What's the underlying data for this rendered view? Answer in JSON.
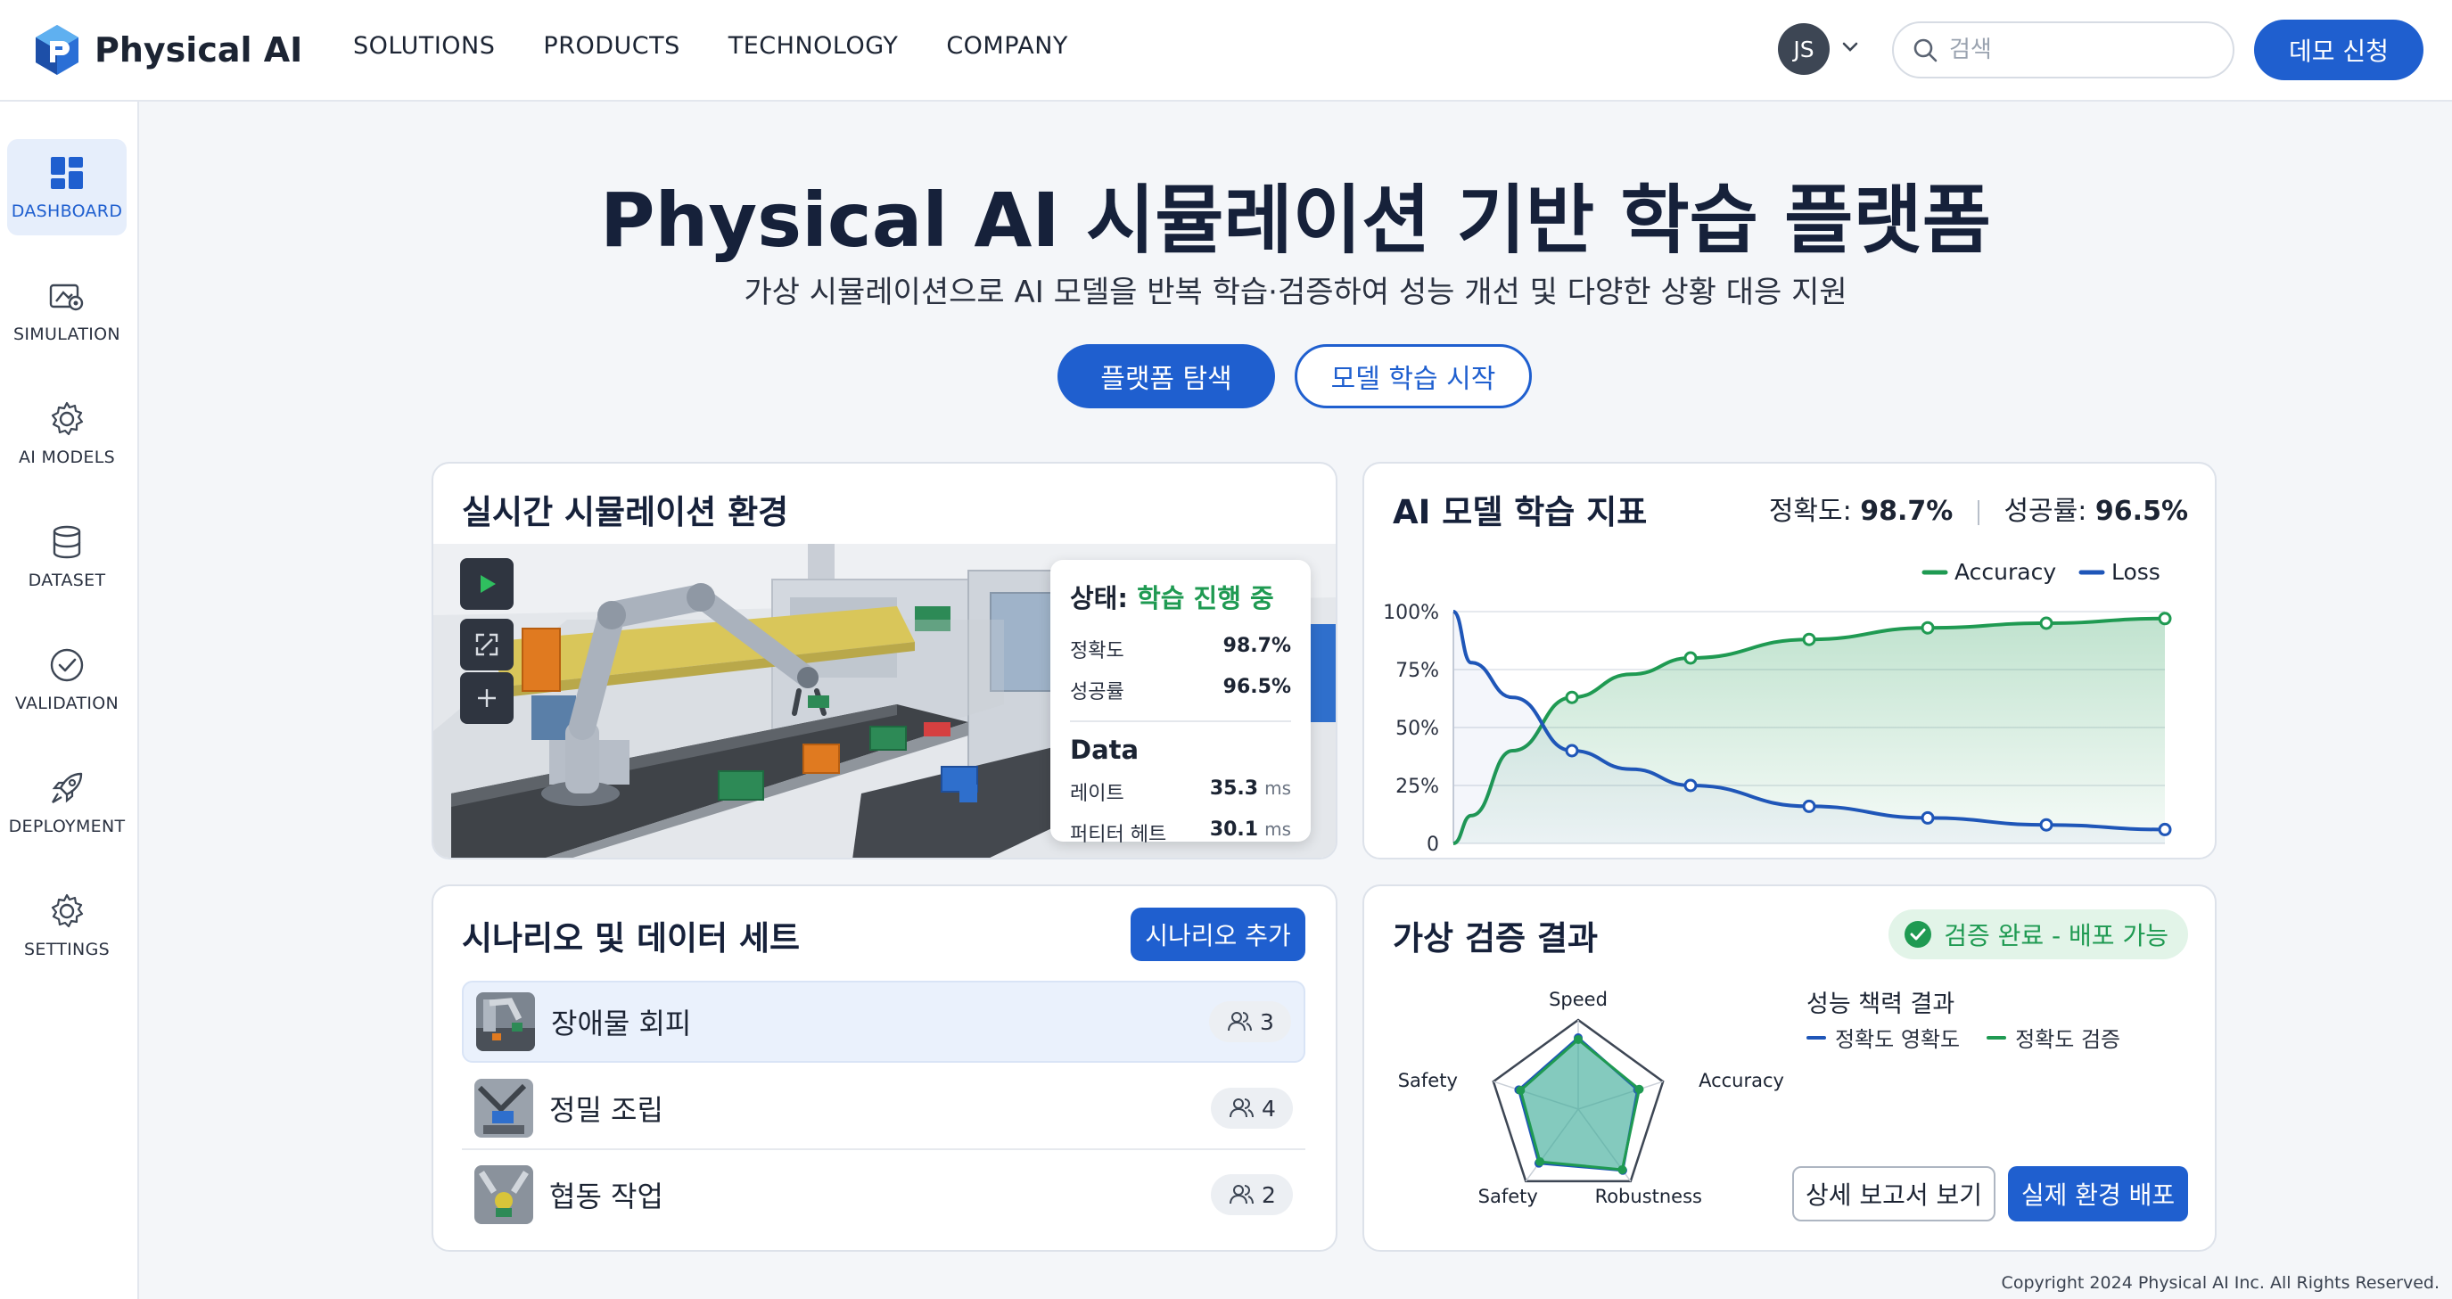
{
  "brand": {
    "name": "Physical AI",
    "primary": "#1f5fcf",
    "success": "#1f9a52"
  },
  "nav": [
    "SOLUTIONS",
    "PRODUCTS",
    "TECHNOLOGY",
    "COMPANY"
  ],
  "header": {
    "avatar_initials": "JS",
    "search_placeholder": "검색",
    "demo_label": "데모 신청"
  },
  "sidebar": [
    {
      "label": "DASHBOARD",
      "icon": "dashboard-icon",
      "active": true
    },
    {
      "label": "SIMULATION",
      "icon": "simulation-icon",
      "active": false
    },
    {
      "label": "AI MODELS",
      "icon": "gear-icon",
      "active": false
    },
    {
      "label": "DATASET",
      "icon": "database-icon",
      "active": false
    },
    {
      "label": "VALIDATION",
      "icon": "check-circle-icon",
      "active": false
    },
    {
      "label": "DEPLOYMENT",
      "icon": "rocket-icon",
      "active": false
    },
    {
      "label": "SETTINGS",
      "icon": "gear-icon",
      "active": false
    }
  ],
  "hero": {
    "title": "Physical AI 시뮬레이션 기반 학습 플랫폼",
    "subtitle": "가상 시뮬레이션으로 AI 모델을 반복 학습·검증하여 성능 개선 및 다양한 상황 대응 지원",
    "primary_button": "플랫폼 탐색",
    "secondary_button": "모델 학습 시작"
  },
  "simulation": {
    "title": "실시간 시뮬레이션 환경",
    "status_label": "상태:",
    "status_value": "학습 진행 중",
    "metrics": [
      {
        "label": "정확도",
        "value": "98.7%"
      },
      {
        "label": "성공률",
        "value": "96.5%"
      }
    ],
    "data_title": "Data",
    "data_rows": [
      {
        "label": "레이트",
        "value": "35.3",
        "unit": "ms"
      },
      {
        "label": "퍼티터 헤트",
        "value": "30.1",
        "unit": "ms"
      }
    ]
  },
  "metrics_card": {
    "title": "AI 모델 학습 지표",
    "accuracy_label": "정확도:",
    "accuracy_value": "98.7%",
    "success_label": "성공률:",
    "success_value": "96.5%"
  },
  "chart_data": {
    "type": "line",
    "x": [
      0,
      100,
      200,
      300,
      400,
      500,
      600
    ],
    "x_ticks": [
      "0",
      "100",
      "200",
      "300",
      "400",
      "500",
      "600"
    ],
    "y_ticks": [
      "0",
      "25%",
      "50%",
      "75%",
      "100%"
    ],
    "ylim": [
      0,
      100
    ],
    "xlim": [
      0,
      600
    ],
    "grid": true,
    "legend_position": "top-right",
    "series": [
      {
        "name": "Accuracy",
        "color": "#1f9a52",
        "fill": true,
        "points": [
          [
            0,
            0
          ],
          [
            15,
            12
          ],
          [
            50,
            40
          ],
          [
            100,
            63
          ],
          [
            150,
            73
          ],
          [
            200,
            80
          ],
          [
            300,
            88
          ],
          [
            400,
            93
          ],
          [
            500,
            95
          ],
          [
            600,
            97
          ]
        ],
        "markers": [
          100,
          200,
          300,
          400,
          500,
          600
        ]
      },
      {
        "name": "Loss",
        "color": "#1f56b8",
        "fill": false,
        "points": [
          [
            0,
            100
          ],
          [
            15,
            78
          ],
          [
            50,
            63
          ],
          [
            100,
            40
          ],
          [
            150,
            32
          ],
          [
            200,
            25
          ],
          [
            300,
            16
          ],
          [
            400,
            11
          ],
          [
            500,
            8
          ],
          [
            600,
            6
          ]
        ],
        "markers": [
          100,
          200,
          300,
          400,
          500,
          600
        ]
      }
    ]
  },
  "scenarios": {
    "title": "시나리오 및 데이터 세트",
    "add_label": "시나리오 추가",
    "items": [
      {
        "name": "장애물 회피",
        "count": "3"
      },
      {
        "name": "정밀 조립",
        "count": "4"
      },
      {
        "name": "협동 작업",
        "count": "2"
      }
    ]
  },
  "validation": {
    "title": "가상 검증 결과",
    "badge": "검증 완료 - 배포 가능",
    "perf_title": "성능 책력 결과",
    "legend": [
      {
        "name": "정확도 영확도",
        "color": "#1f56b8"
      },
      {
        "name": "정확도 검증",
        "color": "#1f9a52"
      }
    ],
    "report_button": "상세 보고서 보기",
    "deploy_button": "실제 환경 배포",
    "radar": {
      "axes": [
        "Speed",
        "Accuracy",
        "Robustness",
        "Safety",
        "Safety"
      ],
      "series": [
        {
          "color": "#1f56b8",
          "values": [
            0.8,
            0.7,
            0.85,
            0.75,
            0.7
          ]
        },
        {
          "color": "#1f9a52",
          "values": [
            0.78,
            0.72,
            0.84,
            0.73,
            0.68
          ]
        }
      ]
    }
  },
  "footer": {
    "copyright": "Copyright 2024 Physical AI Inc. All Rights Reserved."
  }
}
